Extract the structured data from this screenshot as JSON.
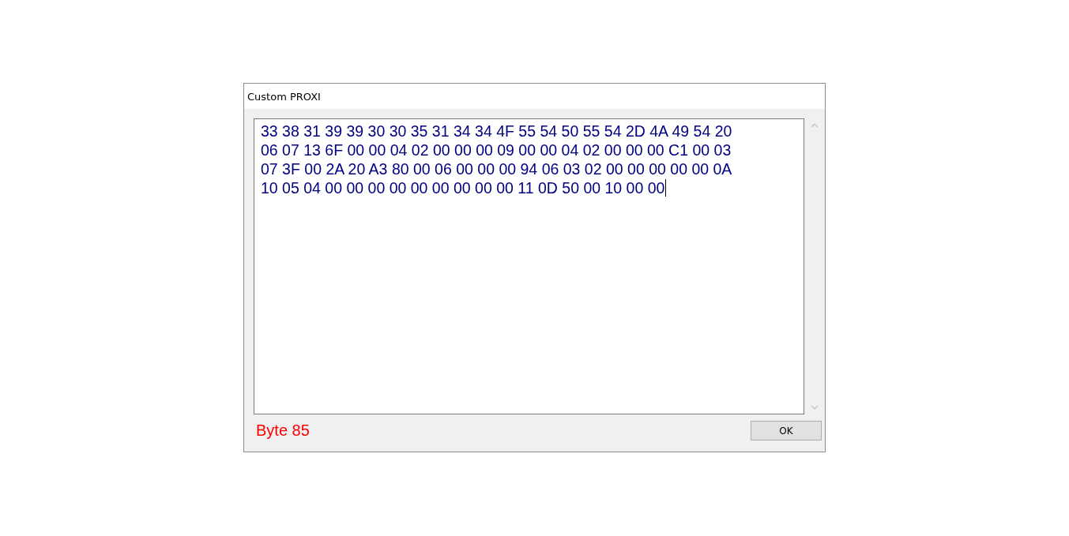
{
  "window": {
    "title": "Custom PROXI"
  },
  "hex_field": {
    "lines": [
      "33 38 31 39 39 30 30 35 31 34 34 4F 55 54 50 55 54 2D 4A 49 54 20",
      "06 07 13 6F 00 00 04 02 00 00 00 09 00 00 04 02 00 00 00 C1 00 03",
      "07 3F 00 2A 20 A3 80 00 06 00 00 00 94 06 03 02 00 00 00 00 00 0A",
      "10 05 04 00 00 00 00 00 00 00 00 00 11 0D 50 00 10 00 00"
    ]
  },
  "status": "Byte 85",
  "buttons": [
    "OK"
  ]
}
